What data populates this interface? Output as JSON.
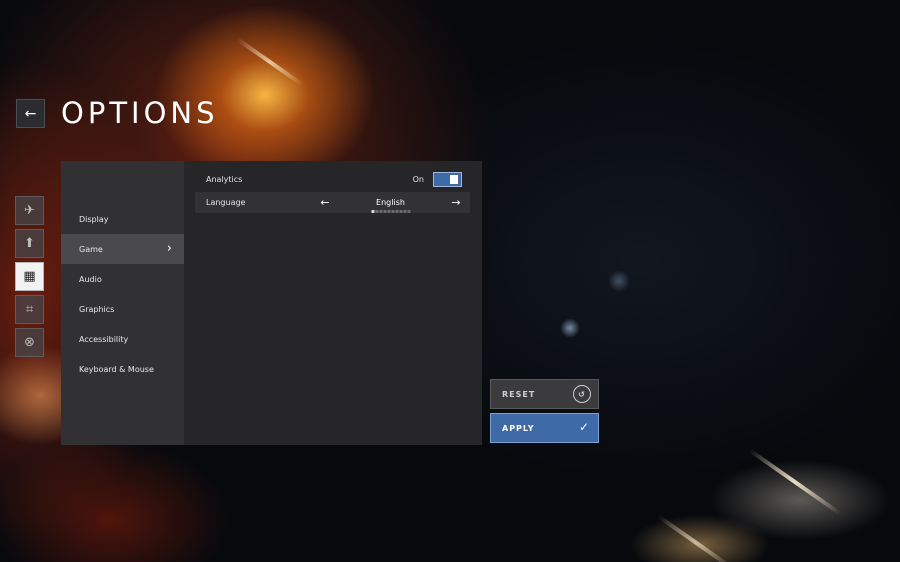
{
  "header": {
    "title": "OPTIONS",
    "back_icon": "←"
  },
  "side_tabs": [
    {
      "icon": "✈",
      "name": "plane-icon"
    },
    {
      "icon": "⬆",
      "name": "upload-icon"
    },
    {
      "icon": "▦",
      "name": "grid-icon"
    },
    {
      "icon": "⌗",
      "name": "controller-icon"
    },
    {
      "icon": "⊗",
      "name": "close-circle-icon"
    }
  ],
  "nav": {
    "items": [
      {
        "label": "Display"
      },
      {
        "label": "Game"
      },
      {
        "label": "Audio"
      },
      {
        "label": "Graphics"
      },
      {
        "label": "Accessibility"
      },
      {
        "label": "Keyboard & Mouse"
      }
    ],
    "active_index": 1,
    "chevron": "›"
  },
  "settings": {
    "analytics": {
      "label": "Analytics",
      "value": "On"
    },
    "language": {
      "label": "Language",
      "value": "English",
      "prev": "←",
      "next": "→"
    }
  },
  "actions": {
    "reset_label": "RESET",
    "reset_icon": "↺",
    "apply_label": "APPLY",
    "apply_icon": "✓"
  },
  "colors": {
    "accent": "#3e6aa8",
    "panel": "#262628",
    "nav": "#313133"
  }
}
